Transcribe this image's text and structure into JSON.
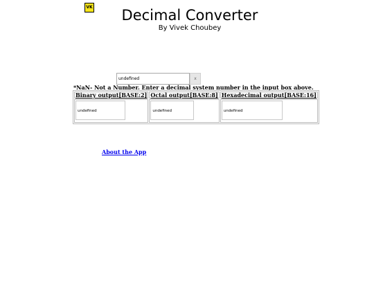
{
  "logo": {
    "text": "VK"
  },
  "header": {
    "title": "Decimal Converter",
    "byline": "By Vivek Choubey"
  },
  "input": {
    "value": "undefined",
    "clear_label": "x"
  },
  "note": "*NaN- Not a Number. Enter a decimal system number in the input box above.",
  "outputs": {
    "headers": [
      "Binary output[BASE:2]",
      "Octal output[BASE:8]",
      "Hexadecimal output[BASE:16]"
    ],
    "values": [
      "undefined",
      "undefined",
      "undefined"
    ]
  },
  "links": {
    "about": "About the App"
  }
}
